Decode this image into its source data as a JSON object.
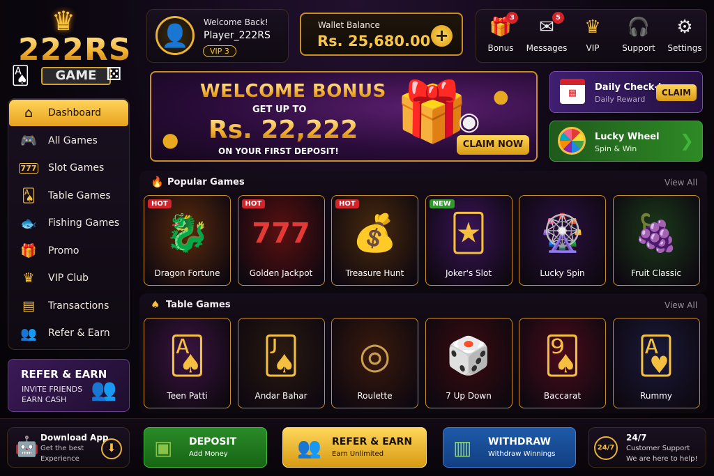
{
  "brand": {
    "name": "222RS",
    "sub": "GAME"
  },
  "sidebar": {
    "items": [
      {
        "label": "Dashboard",
        "icon": "home-icon",
        "glyph": "⌂",
        "active": true
      },
      {
        "label": "All Games",
        "icon": "gamepad-icon",
        "glyph": "🎮"
      },
      {
        "label": "Slot Games",
        "icon": "slot-777-icon",
        "glyph": "777"
      },
      {
        "label": "Table Games",
        "icon": "cards-icon",
        "glyph": "🂡"
      },
      {
        "label": "Fishing Games",
        "icon": "fish-icon",
        "glyph": "🐟"
      },
      {
        "label": "Promo",
        "icon": "gift-icon",
        "glyph": "🎁"
      },
      {
        "label": "VIP Club",
        "icon": "vip-crown-icon",
        "glyph": "♛"
      },
      {
        "label": "Transactions",
        "icon": "receipt-icon",
        "glyph": "▤"
      },
      {
        "label": "Refer & Earn",
        "icon": "users-icon",
        "glyph": "👥"
      }
    ]
  },
  "refer_card": {
    "title": "REFER & EARN",
    "line1": "INVITE FRIENDS",
    "line2": "EARN CASH"
  },
  "user": {
    "welcome": "Welcome Back!",
    "name": "Player_222RS",
    "vip": "VIP 3"
  },
  "wallet": {
    "label": "Wallet Balance",
    "value": "Rs. 25,680.00",
    "add": "+"
  },
  "topnav": [
    {
      "label": "Bonus",
      "icon": "gift-icon",
      "glyph": "🎁",
      "badge": "3"
    },
    {
      "label": "Messages",
      "icon": "envelope-icon",
      "glyph": "✉",
      "badge": "5"
    },
    {
      "label": "VIP",
      "icon": "crown-icon",
      "glyph": "♛",
      "badge": ""
    },
    {
      "label": "Support",
      "icon": "headset-icon",
      "glyph": "🎧",
      "badge": ""
    },
    {
      "label": "Settings",
      "icon": "gear-icon",
      "glyph": "⚙",
      "badge": ""
    }
  ],
  "banner": {
    "heading": "WELCOME BONUS",
    "getup": "GET UP TO",
    "amount": "Rs. 22,222",
    "footer": "ON YOUR FIRST DEPOSIT!",
    "cta": "CLAIM NOW"
  },
  "checkin": {
    "title": "Daily Check-in",
    "sub": "Daily Reward",
    "cta": "CLAIM"
  },
  "wheel": {
    "title": "Lucky Wheel",
    "sub": "Spin & Win"
  },
  "popular": {
    "title": "Popular Games",
    "view_all": "View All",
    "games": [
      {
        "name": "Dragon Fortune",
        "tag": "HOT",
        "glyph": "🐉",
        "bg": "#5a2a0c"
      },
      {
        "name": "Golden Jackpot",
        "tag": "HOT",
        "glyph": "777",
        "bg": "#5a1010"
      },
      {
        "name": "Treasure Hunt",
        "tag": "HOT",
        "glyph": "💰",
        "bg": "#4a2a0c"
      },
      {
        "name": "Joker's Slot",
        "tag": "NEW",
        "glyph": "🃏",
        "bg": "#3a1458"
      },
      {
        "name": "Lucky Spin",
        "tag": "",
        "glyph": "🎡",
        "bg": "#2a1040"
      },
      {
        "name": "Fruit Classic",
        "tag": "",
        "glyph": "🍇",
        "bg": "#1a3a1a"
      }
    ]
  },
  "table": {
    "title": "Table Games",
    "view_all": "View All",
    "games": [
      {
        "name": "Teen Patti",
        "glyph": "🂡",
        "bg": "#3a1440"
      },
      {
        "name": "Andar Bahar",
        "glyph": "🂫",
        "bg": "#2a1a10"
      },
      {
        "name": "Roulette",
        "glyph": "◎",
        "bg": "#3a1a0c"
      },
      {
        "name": "7 Up Down",
        "glyph": "🎲",
        "bg": "#3a0c10"
      },
      {
        "name": "Baccarat",
        "glyph": "🂩",
        "bg": "#4a0c1a"
      },
      {
        "name": "Rummy",
        "glyph": "🂱",
        "bg": "#1a1a3a"
      }
    ]
  },
  "download": {
    "title": "Download App",
    "line1": "Get the best",
    "line2": "Experience"
  },
  "actions": {
    "deposit": {
      "title": "DEPOSIT",
      "sub": "Add Money"
    },
    "refer": {
      "title": "REFER & EARN",
      "sub": "Earn Unlimited"
    },
    "withdraw": {
      "title": "WITHDRAW",
      "sub": "Withdraw Winnings"
    }
  },
  "support": {
    "title": "24/7",
    "line1": "Customer Support",
    "line2": "We are here to help!",
    "badge": "24/7"
  }
}
